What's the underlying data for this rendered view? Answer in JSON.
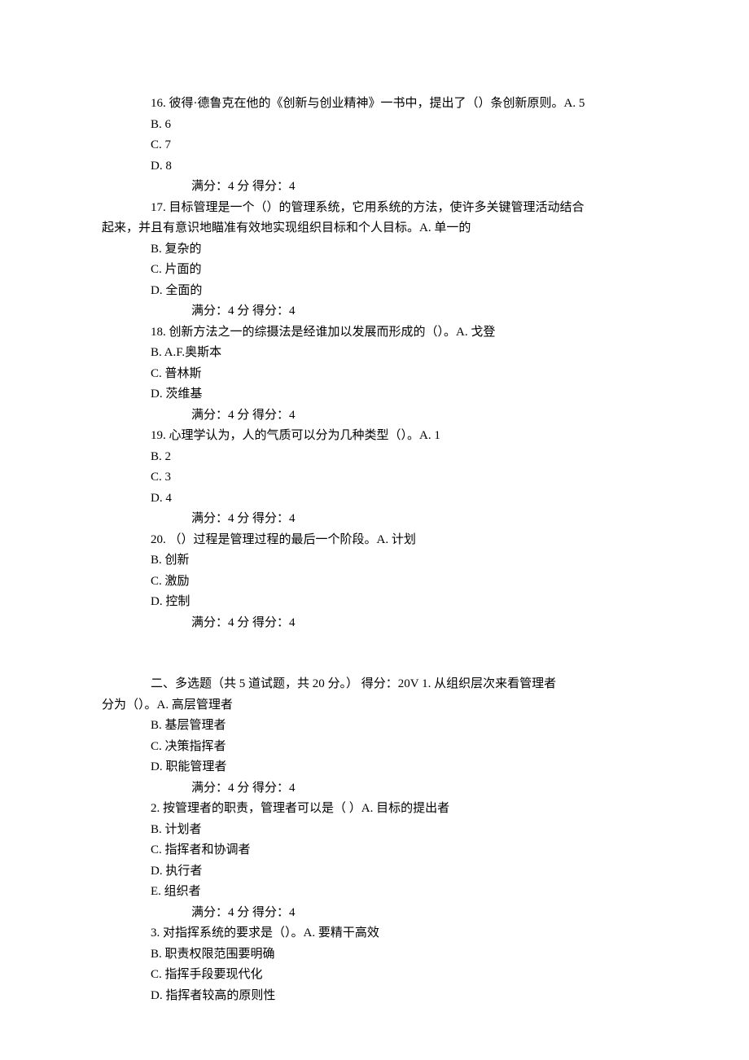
{
  "q16": {
    "line1": "16.   彼得·德鲁克在他的《创新与创业精神》一书中，提出了（）条创新原则。A. 5",
    "b": "B. 6",
    "c": "C. 7",
    "d": "D. 8",
    "score": "满分：4   分   得分：4"
  },
  "q17": {
    "line1": "17.   目标管理是一个（）的管理系统，它用系统的方法，使许多关键管理活动结合",
    "line2": "起来，并且有意识地瞄准有效地实现组织目标和个人目标。A. 单一的",
    "b": "B. 复杂的",
    "c": "C. 片面的",
    "d": "D. 全面的",
    "score": "满分：4   分   得分：4"
  },
  "q18": {
    "line1": "18.   创新方法之一的综摄法是经谁加以发展而形成的（）。A. 戈登",
    "b": "B. A.F.奥斯本",
    "c": "C. 普林斯",
    "d": "D. 茨维基",
    "score": "满分：4   分   得分：4"
  },
  "q19": {
    "line1": "19.   心理学认为，人的气质可以分为几种类型（）。A. 1",
    "b": "B. 2",
    "c": "C. 3",
    "d": "D. 4",
    "score": "满分：4   分   得分：4"
  },
  "q20": {
    "line1": "20.   （）过程是管理过程的最后一个阶段。A. 计划",
    "b": "B. 创新",
    "c": "C. 激励",
    "d": "D. 控制",
    "score": "满分：4   分   得分：4"
  },
  "section2": {
    "line1": "二、多选题（共 5 道试题，共 20 分。）       得分：20V 1.   从组织层次来看管理者",
    "line2": "分为（）。A. 高层管理者"
  },
  "m1": {
    "b": "B. 基层管理者",
    "c": "C. 决策指挥者",
    "d": "D. 职能管理者",
    "score": "满分：4   分   得分：4"
  },
  "m2": {
    "line1": "2.   按管理者的职责，管理者可以是（  ）A. 目标的提出者",
    "b": "B. 计划者",
    "c": "C. 指挥者和协调者",
    "d": "D. 执行者",
    "e": "E. 组织者",
    "score": "满分：4   分   得分：4"
  },
  "m3": {
    "line1": "3.   对指挥系统的要求是（）。A. 要精干高效",
    "b": "B. 职责权限范围要明确",
    "c": "C. 指挥手段要现代化",
    "d": "D. 指挥者较高的原则性"
  }
}
